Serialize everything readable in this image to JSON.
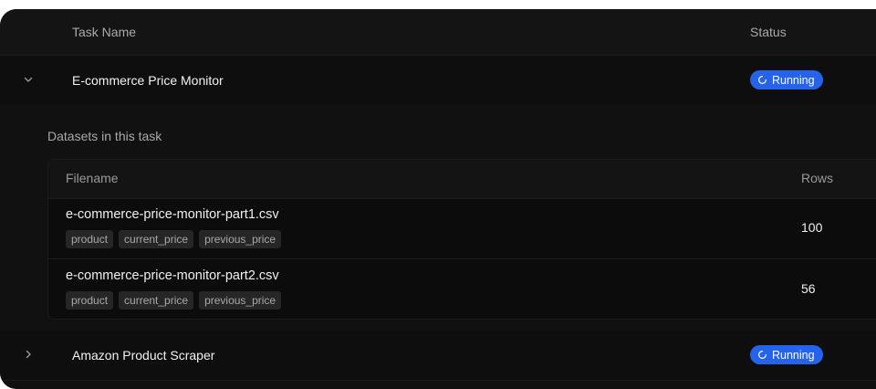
{
  "columns": {
    "task_name": "Task Name",
    "status": "Status"
  },
  "tasks": [
    {
      "name": "E-commerce Price Monitor",
      "status": "Running",
      "expanded": true
    },
    {
      "name": "Amazon Product Scraper",
      "status": "Running",
      "expanded": false
    }
  ],
  "datasets_section": {
    "label": "Datasets in this task",
    "columns": {
      "filename": "Filename",
      "rows": "Rows"
    },
    "files": [
      {
        "filename": "e-commerce-price-monitor-part1.csv",
        "tags": [
          "product",
          "current_price",
          "previous_price"
        ],
        "rows": "100"
      },
      {
        "filename": "e-commerce-price-monitor-part2.csv",
        "tags": [
          "product",
          "current_price",
          "previous_price"
        ],
        "rows": "56"
      }
    ]
  },
  "colors": {
    "running_badge": "#2563eb",
    "background": "#101010"
  },
  "icons": {
    "expanded_chevron": "chevron-down-icon",
    "collapsed_chevron": "chevron-right-icon",
    "status": "loading-spinner-icon"
  }
}
